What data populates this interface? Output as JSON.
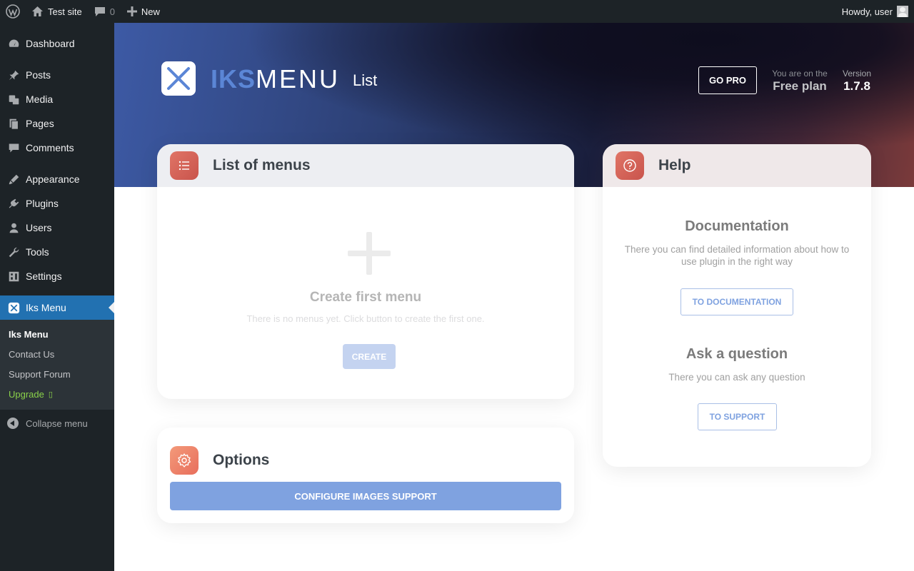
{
  "adminbar": {
    "site_name": "Test site",
    "comments_count": "0",
    "new_label": "New",
    "howdy": "Howdy, user"
  },
  "sidebar": {
    "items": [
      {
        "label": "Dashboard",
        "icon": "dashboard-icon"
      },
      {
        "label": "Posts",
        "icon": "pin-icon"
      },
      {
        "label": "Media",
        "icon": "media-icon"
      },
      {
        "label": "Pages",
        "icon": "pages-icon"
      },
      {
        "label": "Comments",
        "icon": "comment-icon"
      },
      {
        "label": "Appearance",
        "icon": "brush-icon"
      },
      {
        "label": "Plugins",
        "icon": "plugin-icon"
      },
      {
        "label": "Users",
        "icon": "user-icon"
      },
      {
        "label": "Tools",
        "icon": "wrench-icon"
      },
      {
        "label": "Settings",
        "icon": "settings-icon"
      },
      {
        "label": "Iks Menu",
        "icon": "iks-menu-icon"
      }
    ],
    "submenu": [
      "Iks Menu",
      "Contact Us",
      "Support Forum",
      "Upgrade"
    ],
    "upgrade_glyph": "▯",
    "collapse_label": "Collapse menu"
  },
  "header": {
    "logo_bold": "IKS",
    "logo_light": "MENU",
    "page_name": "List",
    "go_pro": "GO PRO",
    "plan_label": "You are on the",
    "plan_value": "Free plan",
    "version_label": "Version",
    "version_value": "1.7.8"
  },
  "list_card": {
    "title": "List of menus",
    "empty_title": "Create first menu",
    "empty_sub": "There is no menus yet. Click button to create the first one.",
    "create_button": "CREATE"
  },
  "options_card": {
    "title": "Options",
    "configure_button": "CONFIGURE IMAGES SUPPORT"
  },
  "help_card": {
    "title": "Help",
    "doc_title": "Documentation",
    "doc_desc": "There you can find detailed information about how to use plugin in the right way",
    "doc_button": "TO DOCUMENTATION",
    "ask_title": "Ask a question",
    "ask_desc": "There you can ask any question",
    "ask_button": "TO SUPPORT"
  },
  "colors": {
    "admin_bg": "#1d2327",
    "active_blue": "#2271b1",
    "brand_blue": "#5b86d6",
    "button_blue": "#7fa2e0",
    "upgrade_green": "#8ad14a",
    "icon_red": "#d9645a"
  }
}
